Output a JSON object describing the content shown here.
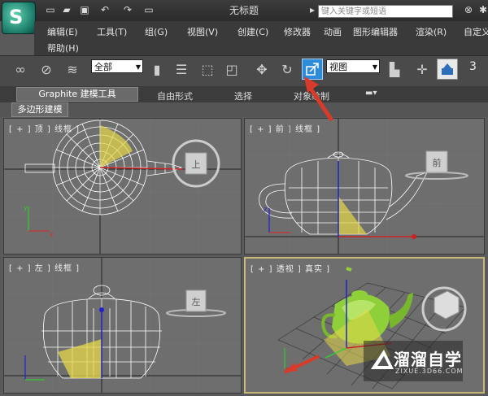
{
  "window": {
    "title": "无标题",
    "search_placeholder": "键入关键字或短语"
  },
  "menu": {
    "row1": [
      "编辑(E)",
      "工具(T)",
      "组(G)",
      "视图(V)",
      "创建(C)",
      "修改器",
      "动画",
      "图形编辑器",
      "渲染(R)",
      "自定义"
    ],
    "row2": [
      "帮助(H)"
    ]
  },
  "toolbar": {
    "selection_filter": "全部",
    "ref_coord": "视图",
    "snap_label": "3"
  },
  "ribbon": {
    "tabs": [
      "Graphite 建模工具",
      "自由形式",
      "选择",
      "对象绘制"
    ],
    "subtab": "多边形建模"
  },
  "viewports": {
    "top": {
      "label": "[ + ] 顶 ] 线框 ]",
      "cube": "上"
    },
    "front": {
      "label": "[ + ] 前 ] 线框 ]",
      "cube": "前"
    },
    "left": {
      "label": "[ + ] 左 ] 线框 ]",
      "cube": "左"
    },
    "perspective": {
      "label": "[ + ] 透视 ] 真实 ]"
    }
  },
  "watermark": {
    "title": "溜溜自学",
    "url": "ZIXUE.3D66.COM"
  },
  "colors": {
    "accent": "#2d8bd8",
    "wire": "#ffffff",
    "teapot_shaded": "#8fcf3a",
    "arrow": "#d93a2a",
    "active_border": "#c9b67a"
  }
}
